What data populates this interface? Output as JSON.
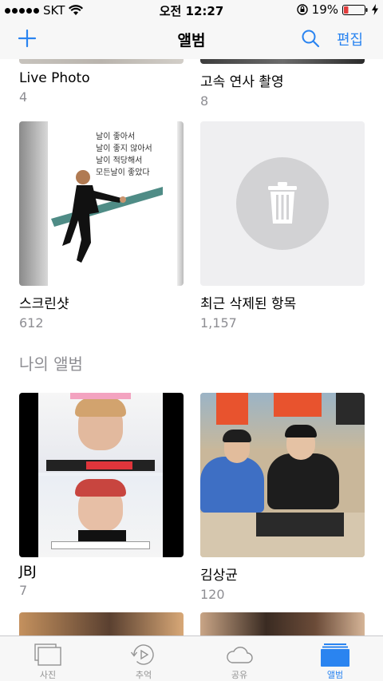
{
  "status_bar": {
    "carrier": "SKT",
    "time": "오전 12:27",
    "battery": "19%"
  },
  "nav": {
    "title": "앨범",
    "edit_label": "편집"
  },
  "albums_top": [
    {
      "name": "Live Photo",
      "count": "4"
    },
    {
      "name": "고속 연사 촬영",
      "count": "8"
    },
    {
      "name": "스크린샷",
      "count": "612"
    },
    {
      "name": "최근 삭제된 항목",
      "count": "1,157"
    }
  ],
  "screenshot_caption": [
    "날이 좋아서",
    "날이 좋지 않아서",
    "날이 적당해서",
    "모든날이 좋았다"
  ],
  "my_albums": {
    "header": "나의 앨범",
    "items": [
      {
        "name": "JBJ",
        "count": "7"
      },
      {
        "name": "김상균",
        "count": "120"
      }
    ]
  },
  "tabs": [
    {
      "label": "사진",
      "icon": "photos-icon"
    },
    {
      "label": "추억",
      "icon": "memories-icon"
    },
    {
      "label": "공유",
      "icon": "cloud-icon"
    },
    {
      "label": "앨범",
      "icon": "albums-icon",
      "active": true
    }
  ],
  "colors": {
    "accent": "#2a84f0",
    "secondary_text": "#8e8e93",
    "bar_background": "#f7f7f7"
  }
}
